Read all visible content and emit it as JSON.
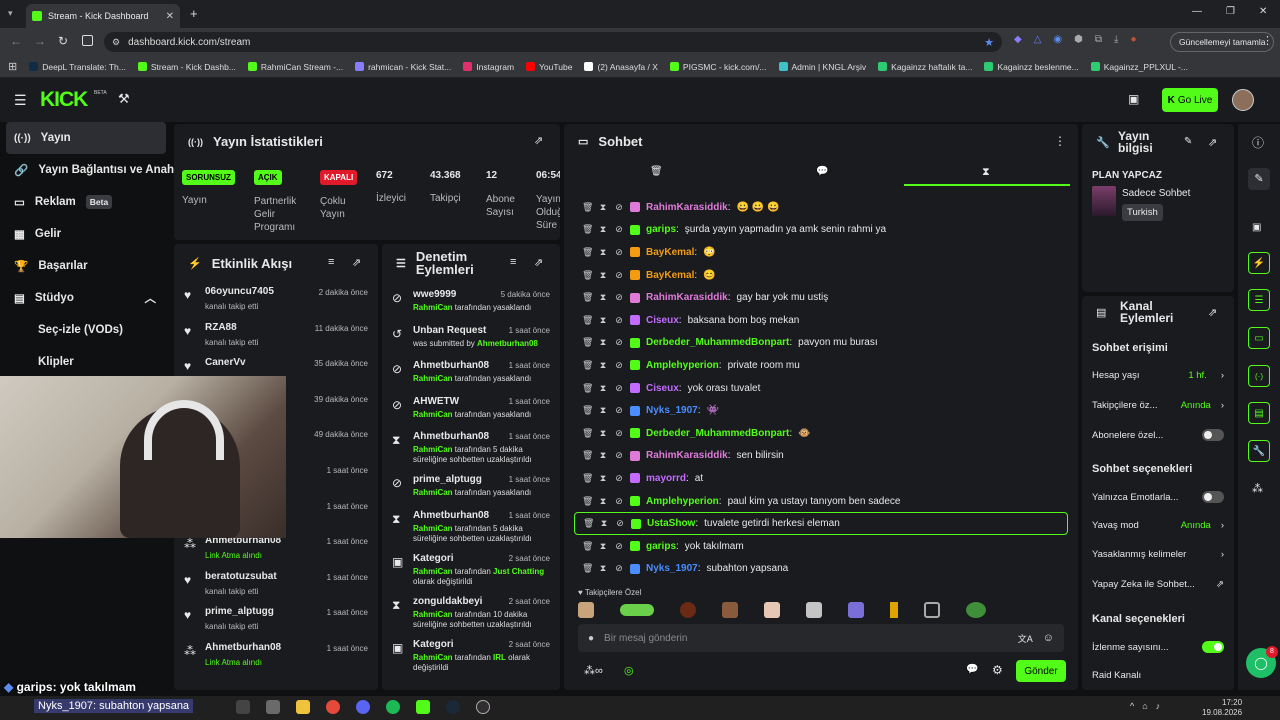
{
  "browser": {
    "tab_title": "Stream - Kick Dashboard",
    "url": "dashboard.kick.com/stream",
    "update_button": "Güncellemeyi tamamla",
    "bookmarks": [
      "DeepL Translate: Th...",
      "Stream - Kick Dashb...",
      "RahmiCan Stream -...",
      "rahmican - Kick Stat...",
      "Instagram",
      "YouTube",
      "(2) Anasayfa / X",
      "PIGSMC - kick.com/...",
      "Admin | KNGL Arşiv",
      "Kagainzz haftalık ta...",
      "Kagainzz beslenme...",
      "Kagainzz_PPLXUL -..."
    ]
  },
  "header": {
    "logo": "KICK",
    "beta": "BETA",
    "go_live": "Go Live"
  },
  "sidebar": {
    "items": [
      "Yayın",
      "Yayın Bağlantısı ve Anahtarı",
      "Reklam",
      "Gelir",
      "Başarılar",
      "Stüdyo",
      "Seç-izle (VODs)",
      "Klipler"
    ],
    "reklam_badge": "Beta"
  },
  "stats": {
    "title": "Yayın İstatistikleri",
    "cards": [
      {
        "badge": "SORUNSUZ",
        "label": "Yayın",
        "color": "#53fc18"
      },
      {
        "badge": "AÇIK",
        "label": "Partnerlik Gelir Programı",
        "color": "#53fc18"
      },
      {
        "badge": "KAPALI",
        "label": "Çoklu Yayın",
        "color": "#e0192b"
      },
      {
        "value": "672",
        "label": "İzleyici"
      },
      {
        "value": "43.368",
        "label": "Takipçi"
      },
      {
        "value": "12",
        "label": "Abone Sayısı"
      },
      {
        "value": "06:54",
        "label": "Yayın Olduğu Süre"
      }
    ]
  },
  "activity": {
    "title": "Etkinlik Akışı",
    "items": [
      {
        "name": "06oyuncu7405",
        "sub": "kanalı takip etti",
        "time": "2 dakika önce",
        "icon": "heart"
      },
      {
        "name": "RZA88",
        "sub": "kanalı takip etti",
        "time": "11 dakika önce",
        "icon": "heart"
      },
      {
        "name": "CanerVv",
        "sub": "",
        "time": "35 dakika önce",
        "icon": "heart"
      },
      {
        "name": "",
        "sub": "",
        "time": "39 dakika önce",
        "icon": ""
      },
      {
        "name": "",
        "sub": "",
        "time": "49 dakika önce",
        "icon": ""
      },
      {
        "name": "",
        "sub": "",
        "time": "1 saat önce",
        "icon": ""
      },
      {
        "name": "",
        "sub": "",
        "time": "1 saat önce",
        "icon": ""
      },
      {
        "name": "Ahmetburhan08",
        "sub": "Link Atma alındı",
        "time": "1 saat önce",
        "icon": "ban"
      },
      {
        "name": "beratotuzsubat",
        "sub": "kanalı takip etti",
        "time": "1 saat önce",
        "icon": "heart"
      },
      {
        "name": "prime_alptugg",
        "sub": "kanalı takip etti",
        "time": "1 saat önce",
        "icon": "heart"
      },
      {
        "name": "Ahmetburhan08",
        "sub": "Link Atma alındı",
        "time": "1 saat önce",
        "icon": "ban"
      }
    ]
  },
  "moderation": {
    "title": "Denetim Eylemleri",
    "items": [
      {
        "name": "wwe9999",
        "by": "RahmiCan",
        "text": " tarafından yasaklandı",
        "time": "5 dakika önce",
        "icon": "ban"
      },
      {
        "name": "Unban Request",
        "by": "",
        "text": "was submitted by ",
        "by2": "Ahmetburhan08",
        "time": "1 saat önce",
        "icon": "undo"
      },
      {
        "name": "Ahmetburhan08",
        "by": "RahmiCan",
        "text": " tarafından yasaklandı",
        "time": "1 saat önce",
        "icon": "ban"
      },
      {
        "name": "AHWETW",
        "by": "RahmiCan",
        "text": " tarafından yasaklandı",
        "time": "1 saat önce",
        "icon": "ban"
      },
      {
        "name": "Ahmetburhan08",
        "by": "RahmiCan",
        "text": " tarafından 5 dakika süreliğine sohbetten uzaklaştırıldı",
        "time": "1 saat önce",
        "icon": "hourglass"
      },
      {
        "name": "prime_alptugg",
        "by": "RahmiCan",
        "text": " tarafından yasaklandı",
        "time": "1 saat önce",
        "icon": "ban"
      },
      {
        "name": "Ahmetburhan08",
        "by": "RahmiCan",
        "text": " tarafından 5 dakika süreliğine sohbetten uzaklaştırıldı",
        "time": "1 saat önce",
        "icon": "hourglass"
      },
      {
        "name": "Kategori",
        "by": "RahmiCan",
        "text": " tarafından ",
        "cat": "Just Chatting",
        "text2": " olarak değiştirildi",
        "time": "2 saat önce",
        "icon": "cat"
      },
      {
        "name": "zonguldakbeyi",
        "by": "RahmiCan",
        "text": " tarafından 10 dakika süreliğine sohbetten uzaklaştırıldı",
        "time": "2 saat önce",
        "icon": "hourglass"
      },
      {
        "name": "Kategori",
        "by": "RahmiCan",
        "text": " tarafından ",
        "cat": "IRL",
        "text2": " olarak değiştirildi",
        "time": "2 saat önce",
        "icon": "cat"
      }
    ]
  },
  "chat": {
    "title": "Sohbet",
    "messages": [
      {
        "user": "RahimKarasiddik",
        "color": "#e07ad8",
        "text": "😀 😀 😀"
      },
      {
        "user": "garips",
        "color": "#53fc18",
        "text": "şurda yayın yapmadın ya amk senin rahmi ya"
      },
      {
        "user": "BayKemal",
        "color": "#f39c12",
        "text": "😳"
      },
      {
        "user": "BayKemal",
        "color": "#f39c12",
        "text": "😊"
      },
      {
        "user": "RahimKarasiddik",
        "color": "#e07ad8",
        "text": "gay bar yok mu ustiş"
      },
      {
        "user": "Ciseux",
        "color": "#c36bff",
        "text": "baksana bom boş mekan"
      },
      {
        "user": "Derbeder_MuhammedBonpart",
        "color": "#53fc18",
        "text": "pavyon mu burası"
      },
      {
        "user": "Amplehyperion",
        "color": "#53fc18",
        "text": "private room mu"
      },
      {
        "user": "Ciseux",
        "color": "#c36bff",
        "text": "yok orası tuvalet"
      },
      {
        "user": "Nyks_1907",
        "color": "#4b8dff",
        "text": "👾"
      },
      {
        "user": "Derbeder_MuhammedBonpart",
        "color": "#53fc18",
        "text": "🐵"
      },
      {
        "user": "RahimKarasiddik",
        "color": "#e07ad8",
        "text": "sen bilirsin"
      },
      {
        "user": "mayorrd",
        "color": "#c36bff",
        "text": "at"
      },
      {
        "user": "Amplehyperion",
        "color": "#53fc18",
        "text": "paul kim ya ustayı tanıyom ben sadece"
      },
      {
        "user": "UstaShow",
        "color": "#53fc18",
        "text": "tuvalete getirdi herkesi eleman"
      },
      {
        "user": "garips",
        "color": "#53fc18",
        "text": "yok takılmam"
      },
      {
        "user": "Nyks_1907",
        "color": "#4b8dff",
        "text": "subahton yapsana"
      }
    ],
    "follower_only": "Takipçilere Özel",
    "placeholder": "Bir mesaj gönderin",
    "send": "Gönder"
  },
  "stream_info": {
    "title": "Yayın bilgisi",
    "plan": "PLAN YAPCAZ",
    "category": "Sadece Sohbet",
    "language": "Turkish"
  },
  "channel_actions": {
    "title": "Kanal Eylemleri",
    "chat_access": "Sohbet erişimi",
    "account_age": "Hesap yaşı",
    "account_age_val": "1 hf.",
    "followers_only": "Takipçilere öz...",
    "followers_only_val": "Anında",
    "subs_only": "Abonelere özel...",
    "chat_options": "Sohbet seçenekleri",
    "emotes_only": "Yalnızca Emotlarla...",
    "slow_mode": "Yavaş mod",
    "slow_mode_val": "Anında",
    "banned_words": "Yasaklanmış kelimeler",
    "ai_chat": "Yapay Zeka ile Sohbet...",
    "channel_options": "Kanal seçenekleri",
    "view_count": "İzlenme sayısını...",
    "raid": "Raid Kanalı"
  },
  "overlay": {
    "chat_user": "garips",
    "chat_text": ": yok takılmam",
    "ticker": "Nyks_1907: subahton yapsana"
  },
  "taskbar": {
    "time": "17:20",
    "date": "19.08.2026",
    "notif": "8"
  }
}
